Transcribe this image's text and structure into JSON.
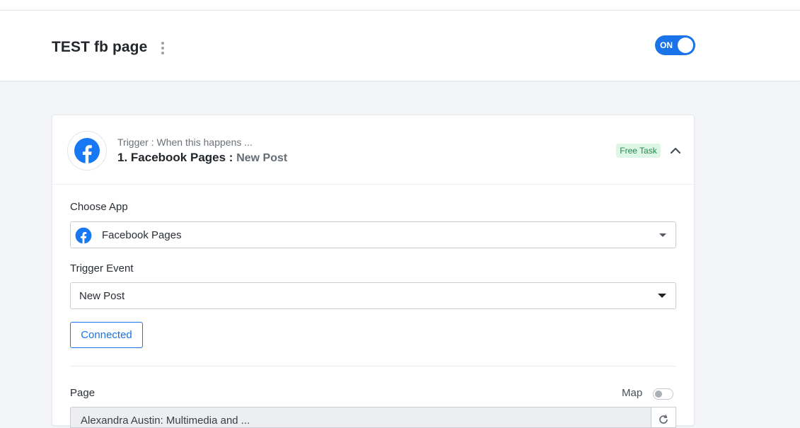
{
  "header": {
    "workflow_title": "TEST fb page",
    "toggle_label": "ON",
    "toggle_color": "#1a73e8"
  },
  "trigger": {
    "subtitle": "Trigger : When this happens ...",
    "title_prefix": "1. Facebook Pages : ",
    "event": "New Post",
    "badge": "Free Task",
    "icon": "facebook-icon",
    "collapse_icon": "chevron-up-icon"
  },
  "form": {
    "choose_app_label": "Choose App",
    "choose_app_value": "Facebook Pages",
    "trigger_event_label": "Trigger Event",
    "trigger_event_value": "New Post",
    "connected_label": "Connected",
    "page_label": "Page",
    "map_label": "Map",
    "page_value": "Alexandra Austin: Multimedia and ...",
    "refresh_icon": "refresh-icon"
  },
  "colors": {
    "accent": "#1a73e8",
    "facebook": "#1877f2",
    "badge_bg": "#ddf6e6",
    "badge_text": "#1f8a4c"
  }
}
